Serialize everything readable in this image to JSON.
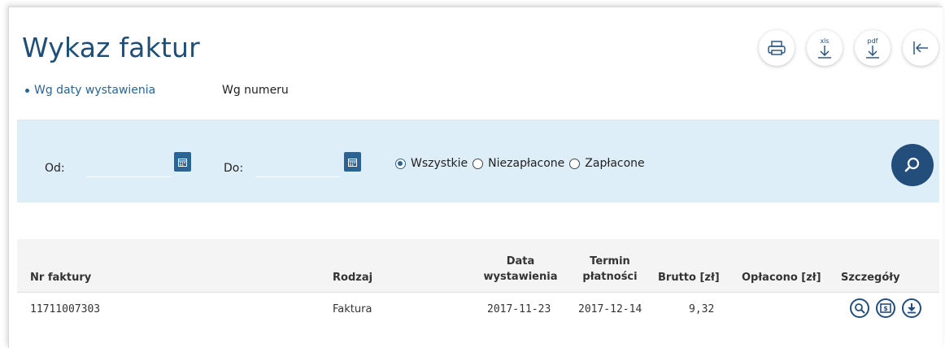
{
  "page": {
    "title": "Wykaz faktur",
    "subnav": {
      "active": "Wg daty wystawienia",
      "other": "Wg numeru"
    }
  },
  "toolbar": {
    "print_icon": "print-icon",
    "xls_label": "xls",
    "pdf_label": "pdf",
    "back_icon": "collapse-left-icon"
  },
  "filter": {
    "from_label": "Od:",
    "to_label": "Do:",
    "from_value": "",
    "to_value": "",
    "options": [
      "Wszystkie",
      "Niezapłacone",
      "Zapłacone"
    ],
    "selected": "Wszystkie"
  },
  "table": {
    "headers": {
      "nr": "Nr faktury",
      "rodzaj": "Rodzaj",
      "data_line1": "Data",
      "data_line2": "wystawienia",
      "termin_line1": "Termin",
      "termin_line2": "płatności",
      "brutto": "Brutto [zł]",
      "oplacono": "Opłacono [zł]",
      "szczegoly": "Szczegóły"
    },
    "rows": [
      {
        "nr": "11711007303",
        "rodzaj": "Faktura",
        "data": "2017-11-23",
        "termin": "2017-12-14",
        "brutto": "9,32",
        "oplacono": ""
      }
    ]
  },
  "colors": {
    "primary": "#234e7c",
    "title": "#1f4e79",
    "filter_bg": "#ddeef8"
  }
}
